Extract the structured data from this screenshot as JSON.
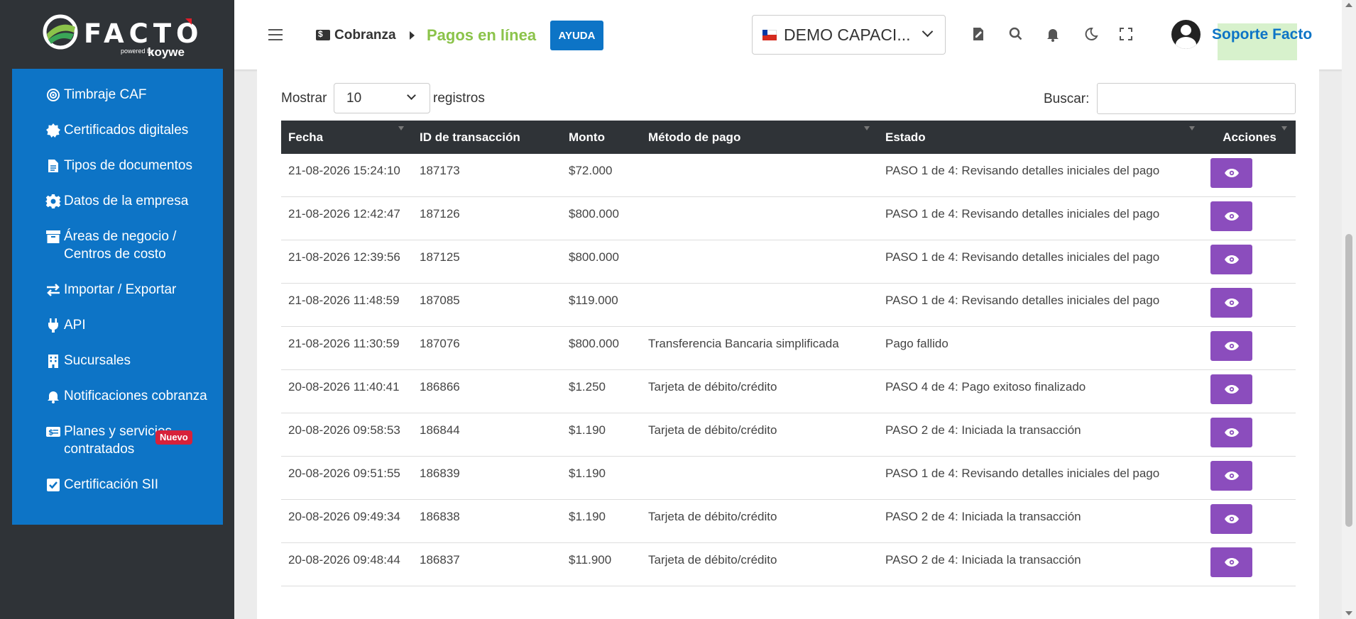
{
  "brand": {
    "name": "FACTO",
    "powered_by": "powered by",
    "partner": "koywe"
  },
  "sidebar": {
    "items": [
      {
        "label": "Timbraje CAF",
        "icon": "target-icon"
      },
      {
        "label": "Certificados digitales",
        "icon": "badge-icon"
      },
      {
        "label": "Tipos de documentos",
        "icon": "document-icon"
      },
      {
        "label": "Datos de la empresa",
        "icon": "gear-icon"
      },
      {
        "label": "Áreas de negocio / Centros de costo",
        "icon": "archive-icon"
      },
      {
        "label": "Importar / Exportar",
        "icon": "swap-arrows-icon"
      },
      {
        "label": "API",
        "icon": "plug-icon"
      },
      {
        "label": "Sucursales",
        "icon": "building-icon"
      },
      {
        "label": "Notificaciones cobranza",
        "icon": "bell-icon"
      },
      {
        "label": "Planes y servicios contratados",
        "icon": "money-card-icon",
        "badge": "Nuevo"
      },
      {
        "label": "Certificación SII",
        "icon": "check-square-icon"
      }
    ]
  },
  "header": {
    "breadcrumb_root": "Cobranza",
    "breadcrumb_current": "Pagos en línea",
    "help_label": "AYUDA",
    "company": "DEMO CAPACI...",
    "user_name": "Soporte Facto",
    "accent_color": "#0d74c6",
    "highlight_color": "#8bc34a"
  },
  "controls": {
    "show_label": "Mostrar",
    "page_size": "10",
    "records_label": "registros",
    "search_label": "Buscar:",
    "search_value": ""
  },
  "table": {
    "columns": [
      "Fecha",
      "ID de transacción",
      "Monto",
      "Método de pago",
      "Estado",
      "Acciones"
    ],
    "rows": [
      {
        "fecha": "21-08-2026 15:24:10",
        "id": "187173",
        "monto": "$72.000",
        "metodo": "",
        "estado": "PASO 1 de 4: Revisando detalles iniciales del pago"
      },
      {
        "fecha": "21-08-2026 12:42:47",
        "id": "187126",
        "monto": "$800.000",
        "metodo": "",
        "estado": "PASO 1 de 4: Revisando detalles iniciales del pago"
      },
      {
        "fecha": "21-08-2026 12:39:56",
        "id": "187125",
        "monto": "$800.000",
        "metodo": "",
        "estado": "PASO 1 de 4: Revisando detalles iniciales del pago"
      },
      {
        "fecha": "21-08-2026 11:48:59",
        "id": "187085",
        "monto": "$119.000",
        "metodo": "",
        "estado": "PASO 1 de 4: Revisando detalles iniciales del pago"
      },
      {
        "fecha": "21-08-2026 11:30:59",
        "id": "187076",
        "monto": "$800.000",
        "metodo": "Transferencia Bancaria simplificada",
        "estado": "Pago fallido"
      },
      {
        "fecha": "20-08-2026 11:40:41",
        "id": "186866",
        "monto": "$1.250",
        "metodo": "Tarjeta de débito/crédito",
        "estado": "PASO 4 de 4: Pago exitoso finalizado"
      },
      {
        "fecha": "20-08-2026 09:58:53",
        "id": "186844",
        "monto": "$1.190",
        "metodo": "Tarjeta de débito/crédito",
        "estado": "PASO 2 de 4: Iniciada la transacción"
      },
      {
        "fecha": "20-08-2026 09:51:55",
        "id": "186839",
        "monto": "$1.190",
        "metodo": "",
        "estado": "PASO 1 de 4: Revisando detalles iniciales del pago"
      },
      {
        "fecha": "20-08-2026 09:49:34",
        "id": "186838",
        "monto": "$1.190",
        "metodo": "Tarjeta de débito/crédito",
        "estado": "PASO 2 de 4: Iniciada la transacción"
      },
      {
        "fecha": "20-08-2026 09:48:44",
        "id": "186837",
        "monto": "$11.900",
        "metodo": "Tarjeta de débito/crédito",
        "estado": "PASO 2 de 4: Iniciada la transacción"
      }
    ],
    "action_button_color": "#8b4dbd"
  }
}
